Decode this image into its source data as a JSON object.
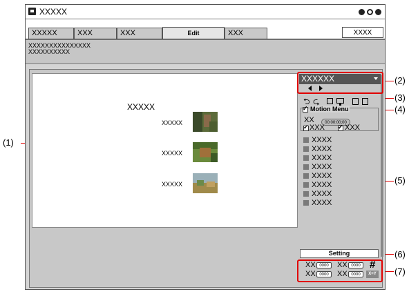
{
  "window": {
    "title": "XXXXX"
  },
  "tabs": [
    {
      "label": "XXXXX"
    },
    {
      "label": "XXX"
    },
    {
      "label": "XXX"
    },
    {
      "label": "Edit"
    },
    {
      "label": "XXX"
    }
  ],
  "tab_right": "XXXX",
  "info": {
    "line1": "XXXXXXXXXXXXXXX",
    "line2": "XXXXXXXXXX"
  },
  "preview": {
    "title": "XXXXX",
    "items": [
      {
        "label": "XXXXX"
      },
      {
        "label": "XXXXX"
      },
      {
        "label": "XXXXX"
      }
    ]
  },
  "panel": {
    "dropdown_value": "XXXXXX",
    "motion_menu_label": "Motion Menu",
    "motion_xx": "XX",
    "timecode": "00:00:00;00",
    "check1": "XXX",
    "check2": "XXX",
    "list": [
      "XXXX",
      "XXXX",
      "XXXX",
      "XXXX",
      "XXXX",
      "XXXX",
      "XXXX",
      "XXXX"
    ],
    "setting_label": "Setting",
    "grid": {
      "row1": [
        {
          "label": "XX",
          "value": "0000"
        },
        {
          "label": "XX",
          "value": "0000"
        }
      ],
      "row2": [
        {
          "label": "XX",
          "value": "0000"
        },
        {
          "label": "XX",
          "value": "0000"
        }
      ],
      "grid_symbol": "#",
      "xy_label": "X=Y"
    }
  },
  "callouts": [
    "(1)",
    "(2)",
    "(3)",
    "(4)",
    "(5)",
    "(6)",
    "(7)"
  ],
  "colors": {
    "callout": "#e10000",
    "dropdown_bg": "#555555"
  }
}
